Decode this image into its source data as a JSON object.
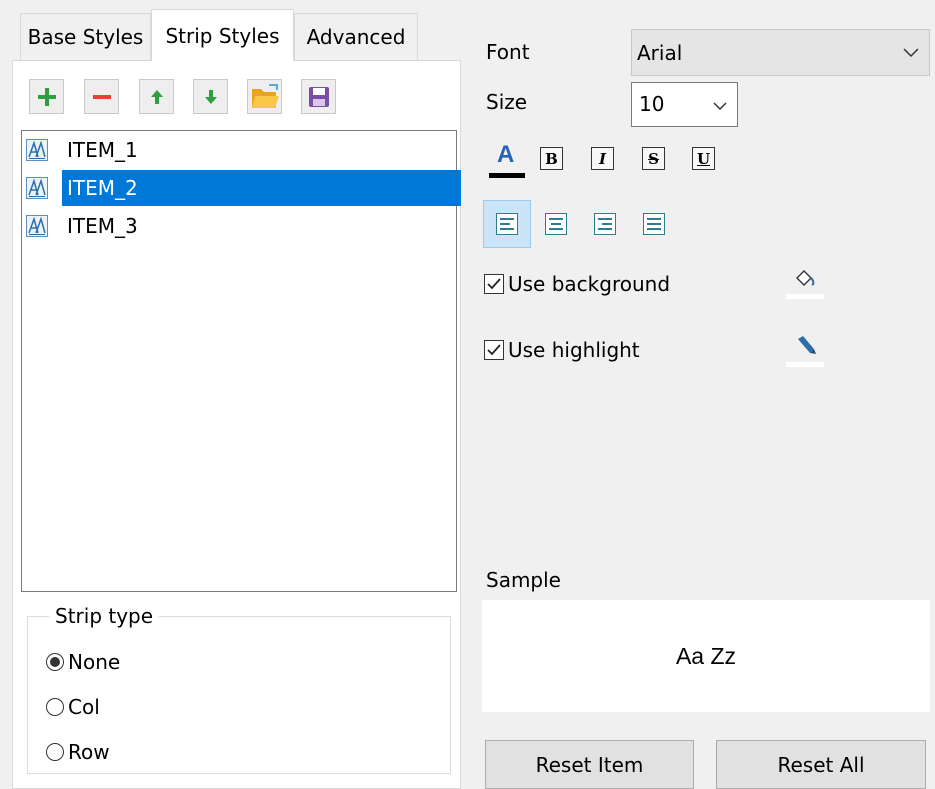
{
  "tabs": [
    {
      "label": "Base Styles",
      "active": false
    },
    {
      "label": "Strip Styles",
      "active": true
    },
    {
      "label": "Advanced",
      "active": false
    }
  ],
  "toolbar": [
    {
      "name": "add",
      "icon": "plus-icon",
      "color": "#2e9e3f"
    },
    {
      "name": "remove",
      "icon": "minus-icon",
      "color": "#e0442f"
    },
    {
      "name": "move-up",
      "icon": "arrow-up-icon",
      "color": "#2e9e3f"
    },
    {
      "name": "move-down",
      "icon": "arrow-down-icon",
      "color": "#2e9e3f"
    },
    {
      "name": "open",
      "icon": "folder-icon",
      "color": "#f5b52c"
    },
    {
      "name": "save",
      "icon": "floppy-disk-icon",
      "color": "#7a4fa3"
    }
  ],
  "items": [
    {
      "label": "ITEM_1",
      "selected": false
    },
    {
      "label": "ITEM_2",
      "selected": true
    },
    {
      "label": "ITEM_3",
      "selected": false
    }
  ],
  "strip_type": {
    "title": "Strip type",
    "options": [
      {
        "label": "None",
        "checked": true
      },
      {
        "label": "Col",
        "checked": false
      },
      {
        "label": "Row",
        "checked": false
      }
    ]
  },
  "font": {
    "label": "Font",
    "value": "Arial"
  },
  "size": {
    "label": "Size",
    "value": "10"
  },
  "format_buttons": {
    "color": "A",
    "bold": "B",
    "italic": "I",
    "strike": "S",
    "underline": "U"
  },
  "checkboxes": {
    "background": {
      "label": "Use background",
      "checked": true
    },
    "highlight": {
      "label": "Use highlight",
      "checked": true
    }
  },
  "sample": {
    "label": "Sample",
    "text": "Aa Zz"
  },
  "buttons": {
    "reset_item": "Reset Item",
    "reset_all": "Reset All"
  },
  "colors": {
    "selection": "#0078d7",
    "accent_icon": "#2d7d8e"
  }
}
